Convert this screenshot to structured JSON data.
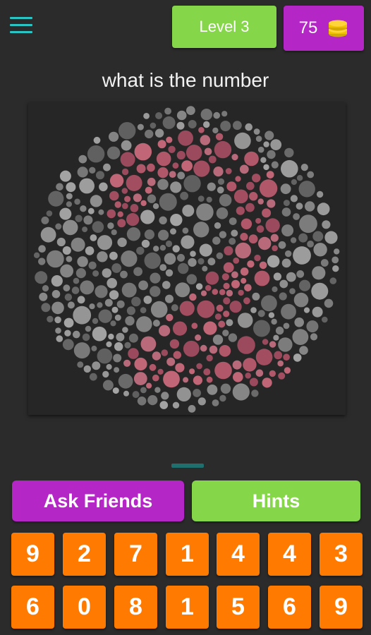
{
  "header": {
    "level_label": "Level 3",
    "coins": "75",
    "menu_icon": "hamburger-menu-icon",
    "coin_icon": "coin-stack-icon"
  },
  "question": "what is the number",
  "plate": {
    "depicted_digit": "2",
    "figure_color": "#b0586a",
    "background_dot_color": "#8a8a8a"
  },
  "actions": {
    "ask_friends_label": "Ask Friends",
    "hints_label": "Hints"
  },
  "keypad": {
    "rows": [
      [
        "9",
        "2",
        "7",
        "1",
        "4",
        "4",
        "3"
      ],
      [
        "6",
        "0",
        "8",
        "1",
        "5",
        "6",
        "9"
      ]
    ]
  },
  "colors": {
    "background": "#2b2b2b",
    "level_green": "#86d64a",
    "accent_purple": "#b526c6",
    "key_orange": "#ff7a00",
    "menu_teal": "#2bc4c4"
  }
}
